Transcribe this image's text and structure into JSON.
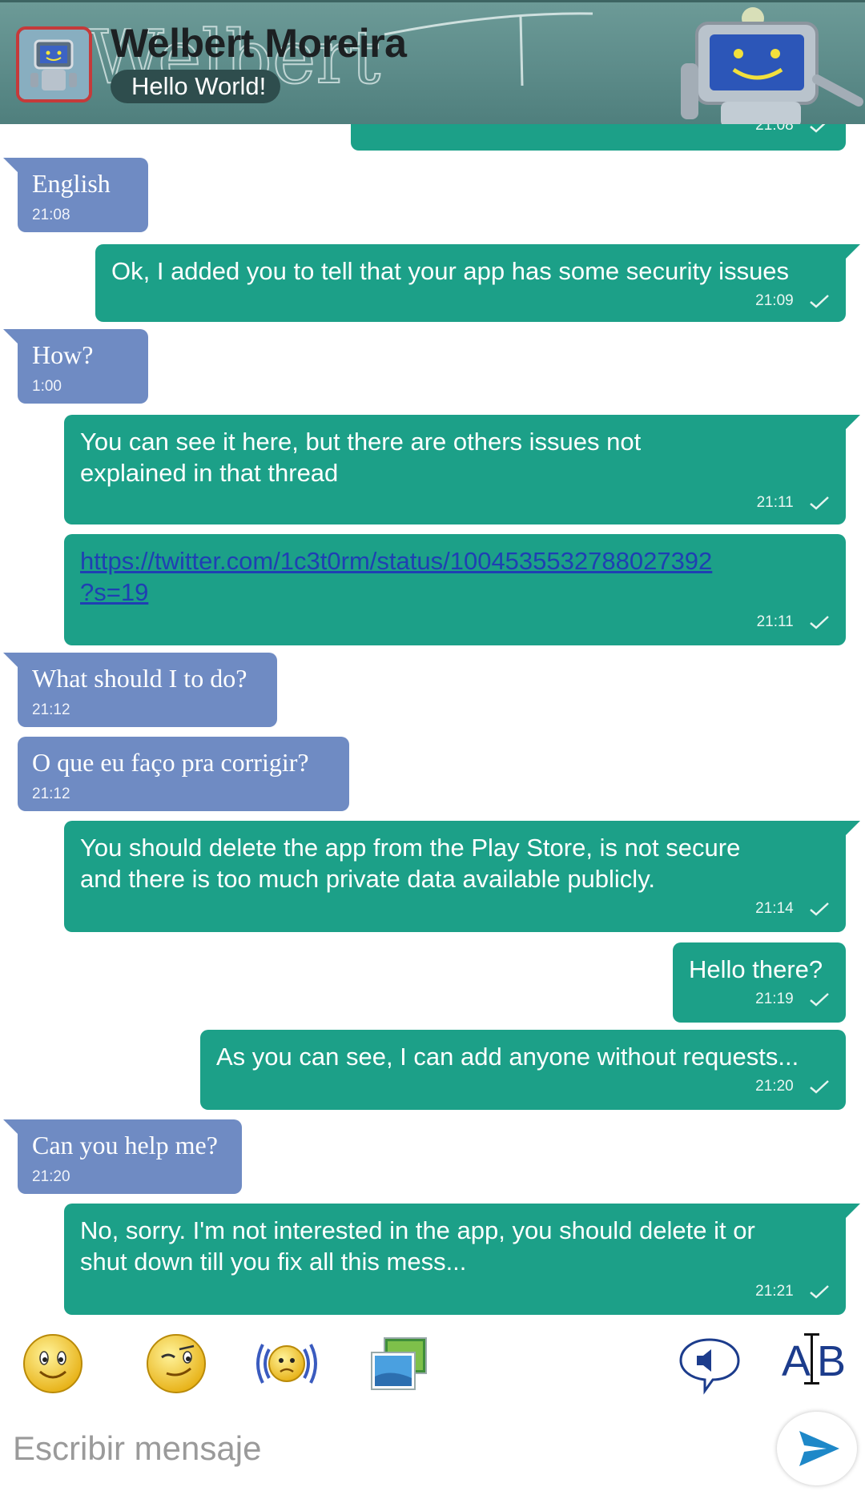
{
  "header": {
    "contact_name": "Welbert Moreira",
    "status": "Hello World!",
    "watermark": "Welbert"
  },
  "messages": [
    {
      "dir": "out",
      "text": "",
      "time": "21:08"
    },
    {
      "dir": "in",
      "text": "English",
      "time": "21:08"
    },
    {
      "dir": "out",
      "text": "Ok, I added you to tell that your app has some security issues",
      "time": "21:09"
    },
    {
      "dir": "in",
      "text": "How?",
      "time": "1:00"
    },
    {
      "dir": "out",
      "text": "You can see it here, but there are others issues not\nexplained in that thread",
      "time": "21:11"
    },
    {
      "dir": "out",
      "text": "https://twitter.com/1c3t0rm/status/1004535532788027392\n?s=19",
      "time": "21:11",
      "is_link": true
    },
    {
      "dir": "in",
      "text": "What should I to do?",
      "time": "21:12"
    },
    {
      "dir": "in",
      "text": "O que eu faço pra corrigir?",
      "time": "21:12"
    },
    {
      "dir": "out",
      "text": "You should delete the app from the Play Store, is not secure\nand there is too much private data available publicly.",
      "time": "21:14"
    },
    {
      "dir": "out",
      "text": "Hello there?",
      "time": "21:19"
    },
    {
      "dir": "out",
      "text": "As you can see, I can add anyone without requests...",
      "time": "21:20"
    },
    {
      "dir": "in",
      "text": "Can you help me?",
      "time": "21:20"
    },
    {
      "dir": "out",
      "text": "No, sorry. I'm not interested in the app, you should delete it or\nshut down till you fix all this mess...",
      "time": "21:21"
    }
  ],
  "toolbar": {
    "icons": [
      "smiley-icon",
      "wink-icon",
      "buzz-icon",
      "image-icon",
      "speaker-icon",
      "text-format-icon"
    ],
    "format_label": "AB"
  },
  "input": {
    "placeholder": "Escribir mensaje",
    "value": ""
  },
  "colors": {
    "outgoing_bubble": "#1ca088",
    "incoming_bubble": "#6f8bc3",
    "header_bg": "#5e8d8b",
    "send_icon": "#1e88c8"
  }
}
